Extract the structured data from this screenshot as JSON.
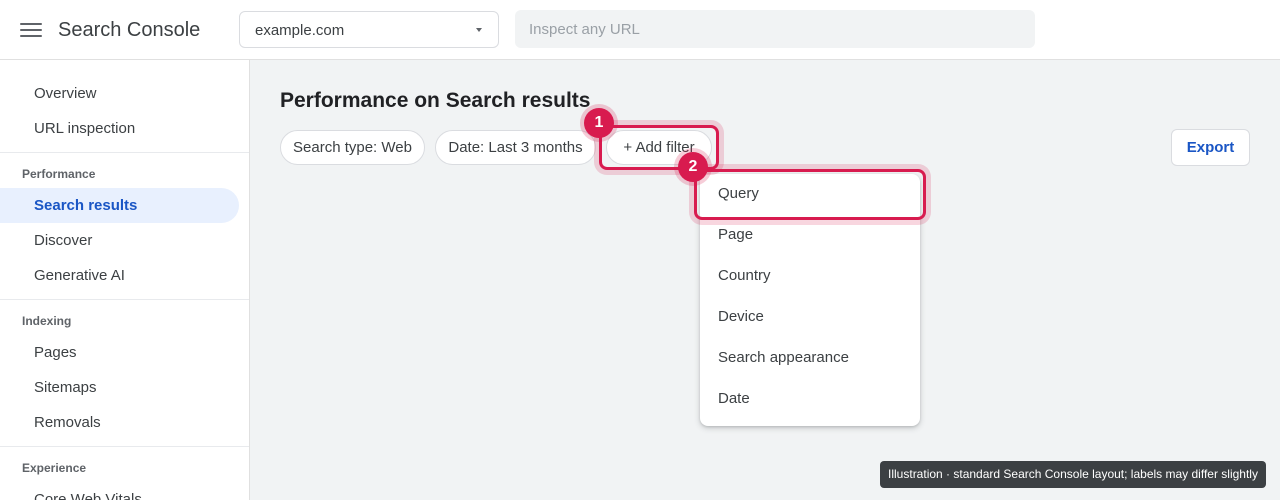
{
  "app": {
    "title": "Search Console"
  },
  "header": {
    "property": "example.com",
    "url_inspect_placeholder": "Inspect any URL"
  },
  "sidebar": {
    "top_items": [
      {
        "label": "Overview"
      },
      {
        "label": "URL inspection"
      }
    ],
    "sections": [
      {
        "title": "Performance",
        "items": [
          {
            "label": "Search results",
            "active": true
          },
          {
            "label": "Discover"
          },
          {
            "label": "Generative AI"
          }
        ]
      },
      {
        "title": "Indexing",
        "items": [
          {
            "label": "Pages"
          },
          {
            "label": "Sitemaps"
          },
          {
            "label": "Removals"
          }
        ]
      },
      {
        "title": "Experience",
        "items": [
          {
            "label": "Core Web Vitals"
          }
        ]
      }
    ]
  },
  "main": {
    "title": "Performance on Search results",
    "filters": [
      {
        "label": "Search type: Web"
      },
      {
        "label": "Date: Last 3 months"
      }
    ],
    "add_filter_label": "+ Add filter",
    "export_label": "Export"
  },
  "filter_menu": {
    "items": [
      "Query",
      "Page",
      "Country",
      "Device",
      "Search appearance",
      "Date"
    ]
  },
  "annotations": {
    "step_1": "1",
    "step_2": "2",
    "caption": "Illustration · standard Search Console layout; labels may differ slightly"
  },
  "colors": {
    "accent": "#1a56c5",
    "active_bg": "#e8f0fe",
    "highlight": "#d81b4f"
  }
}
